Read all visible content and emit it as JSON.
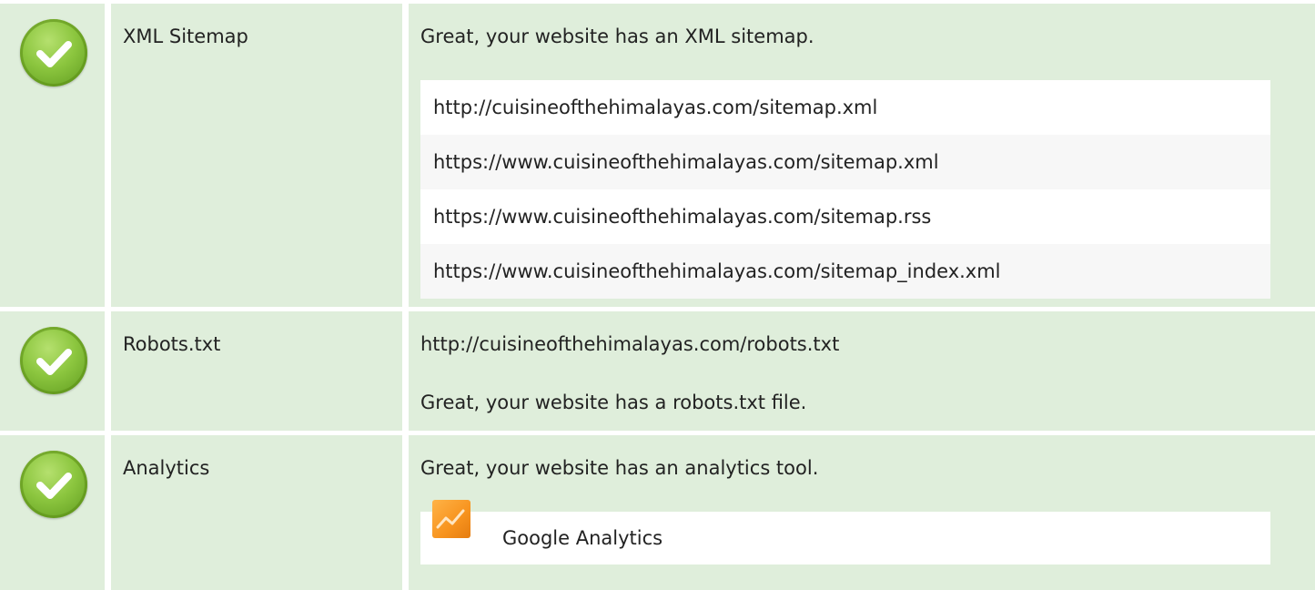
{
  "rows": [
    {
      "name": "XML Sitemap",
      "status_icon": "check-circle-icon",
      "message": "Great, your website has an XML sitemap.",
      "urls": [
        "http://cuisineofthehimalayas.com/sitemap.xml",
        "https://www.cuisineofthehimalayas.com/sitemap.xml",
        "https://www.cuisineofthehimalayas.com/sitemap.rss",
        "https://www.cuisineofthehimalayas.com/sitemap_index.xml"
      ]
    },
    {
      "name": "Robots.txt",
      "status_icon": "check-circle-icon",
      "url": "http://cuisineofthehimalayas.com/robots.txt",
      "message": "Great, your website has a robots.txt file."
    },
    {
      "name": "Analytics",
      "status_icon": "check-circle-icon",
      "message": "Great, your website has an analytics tool.",
      "tools": [
        {
          "icon": "google-analytics-icon",
          "label": "Google Analytics"
        }
      ]
    }
  ],
  "colors": {
    "row_background": "#dfeedb",
    "check_green": "#8cc63f",
    "analytics_orange": "#f7931e"
  }
}
